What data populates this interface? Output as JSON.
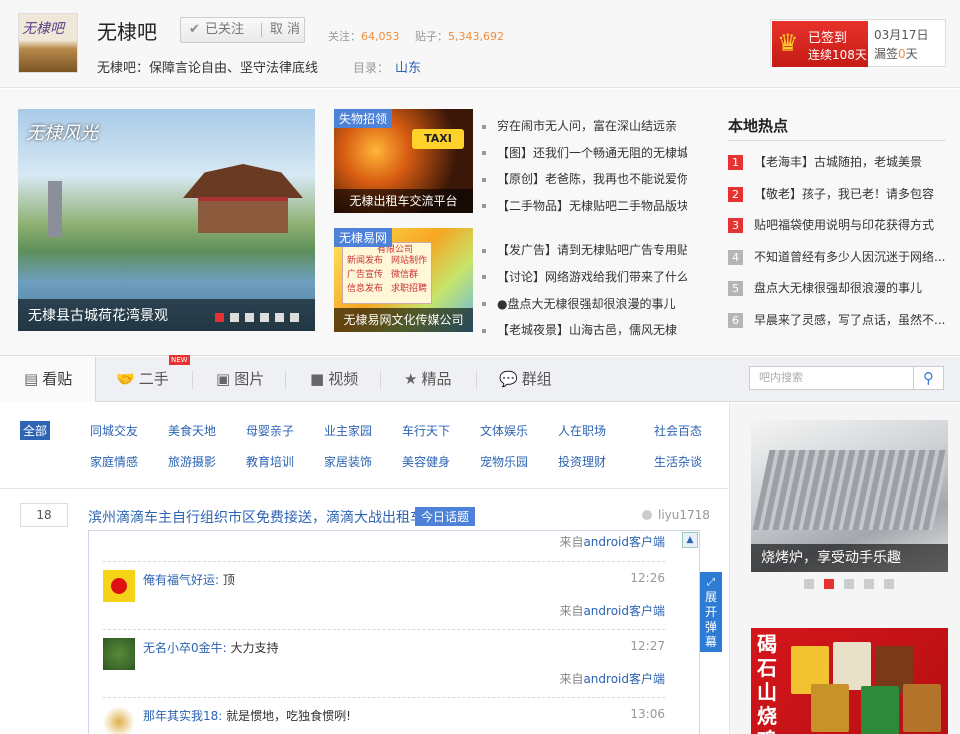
{
  "header": {
    "logo_text": "无棣吧",
    "forum_name": "无棣吧",
    "follow": {
      "check": "✔",
      "label": "已关注",
      "cancel": "取 消"
    },
    "stats": {
      "follow_label": "关注：",
      "follow_count": "64,053",
      "posts_label": "贴子：",
      "posts_count": "5,343,692"
    },
    "slogan": "无棣吧：保障言论自由、坚守法律底线",
    "directory_label": "目录：",
    "directory_value": "山东"
  },
  "sign": {
    "crown": "♛",
    "status": "已签到",
    "streak": "连续108天",
    "date": "03月17日",
    "miss_prefix": "漏签",
    "miss_count": "0",
    "miss_suffix": "天"
  },
  "slider": {
    "overlay_title": "无棣风光",
    "caption": "无棣县古城荷花湾景观",
    "dots": 6,
    "active": 0
  },
  "thumbs": [
    {
      "tag": "失物招领",
      "caption": "无棣出租车交流平台",
      "taxi": "TAXI"
    },
    {
      "tag": "无棣易网",
      "caption": "无棣易网文化传媒公司",
      "ad_top": "有限公司",
      "ad_lines": [
        "新闻发布",
        "网站制作",
        "广告宣传",
        "微信群",
        "信息发布",
        "求职招聘"
      ]
    }
  ],
  "news": [
    "穷在闹市无人问，富在深山结远亲",
    "【图】还我们一个畅通无阻的无棣城",
    "【原创】老爸陈，我再也不能说爱你",
    "【二手物品】无棣贴吧二手物品版块",
    "【发广告】请到无棣贴吧广告专用贴",
    "【讨论】网络游戏给我们带来了什么",
    "●盘点大无棣很强却很浪漫的事儿",
    "【老城夜景】山海古邑，儒风无棣"
  ],
  "hot": {
    "title": "本地热点",
    "items": [
      {
        "n": "1",
        "text": "【老海丰】古城随拍，老城美景"
      },
      {
        "n": "2",
        "text": "【敬老】孩子，我已老！请多包容"
      },
      {
        "n": "3",
        "text": "贴吧福袋使用说明与印花获得方式"
      },
      {
        "n": "4",
        "text": "不知道曾经有多少人因沉迷于网络..."
      },
      {
        "n": "5",
        "text": "盘点大无棣很强却很浪漫的事儿"
      },
      {
        "n": "6",
        "text": "早晨来了灵感，写了点话，虽然不..."
      }
    ]
  },
  "tabs": [
    {
      "icon": "▤",
      "label": "看贴"
    },
    {
      "icon": "🤝",
      "label": "二手"
    },
    {
      "icon": "▣",
      "label": "图片"
    },
    {
      "icon": "■",
      "label": "视频"
    },
    {
      "icon": "★",
      "label": "精品"
    },
    {
      "icon": "💬",
      "label": "群组"
    }
  ],
  "new_badge": "NEW",
  "search": {
    "placeholder": "吧内搜索",
    "icon": "⚲"
  },
  "categories": {
    "row1": [
      "全部",
      "同城交友",
      "美食天地",
      "母婴亲子",
      "业主家园",
      "车行天下",
      "文体娱乐",
      "人在职场",
      "社会百态"
    ],
    "row2": [
      "家庭情感",
      "旅游摄影",
      "教育培训",
      "家居装饰",
      "美容健身",
      "宠物乐园",
      "投资理财",
      "生活杂谈"
    ]
  },
  "thread": {
    "reply_count": "18",
    "title": "滨州滴滴车主自行组织市区免费接送，滴滴大战出租车",
    "tag": "今日话题",
    "author": "liyu1718",
    "source_prefix": "来自",
    "source_device": "android客户端",
    "replies": [
      {
        "user": "俺有福气好运:",
        "text": " 顶",
        "time": "12:26"
      },
      {
        "user": "无名小卒0金牛:",
        "text": " 大力支持",
        "time": "12:27"
      },
      {
        "user": "那年其实我18:",
        "text": " 就是惯地，吃独食惯咧!",
        "time": "13:06"
      }
    ]
  },
  "expand_label": "展开弹幕",
  "ads": {
    "bbq_caption": "烧烤炉，享受动手乐趣",
    "dots": 5,
    "active": 1,
    "food_brand": "碣石山烧鸡"
  },
  "colors": {
    "accent": "#2d64b3",
    "red": "#e53333",
    "orange": "#f08d3c"
  }
}
